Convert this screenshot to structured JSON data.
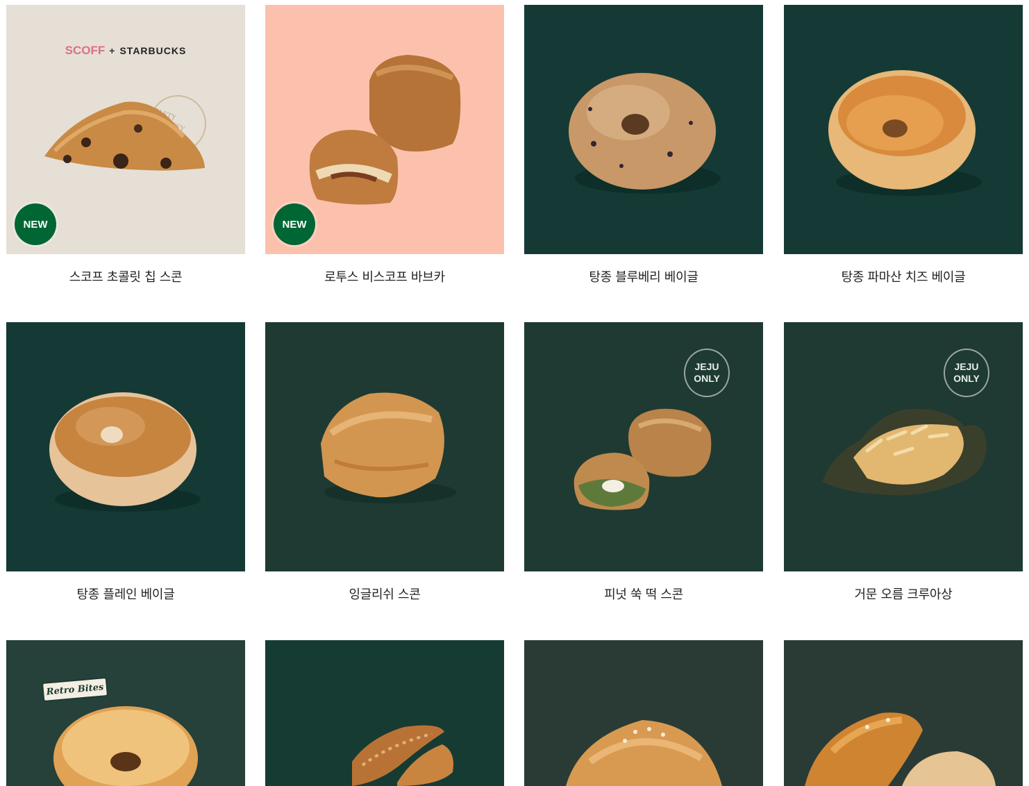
{
  "products": [
    {
      "name": "스코프 초콜릿 칩 스콘",
      "bg": "#e6dfd6",
      "badge": "NEW",
      "collab": {
        "left": "SCOFF",
        "plus": "+",
        "right": "STARBUCKS"
      },
      "stamp": "TASTY JOURNEY",
      "item": "scone"
    },
    {
      "name": "로투스 비스코프 바브카",
      "bg": "#fcc1ad",
      "badge": "NEW",
      "item": "babka"
    },
    {
      "name": "탕종 블루베리 베이글",
      "bg": "#153a35",
      "item": "bagel-blueberry"
    },
    {
      "name": "탕종 파마산 치즈 베이글",
      "bg": "#153a35",
      "item": "bagel-cheese"
    },
    {
      "name": "탕종 플레인 베이글",
      "bg": "#153a35",
      "item": "bagel-plain"
    },
    {
      "name": "잉글리쉬 스콘",
      "bg": "#1e3a33",
      "item": "scone-english"
    },
    {
      "name": "피넛 쑥 떡 스콘",
      "bg": "#1e3a33",
      "jeju": {
        "line1": "JEJU",
        "line2": "ONLY"
      },
      "item": "scone-mugwort"
    },
    {
      "name": "거문 오름 크루아상",
      "bg": "#1e3a33",
      "jeju": {
        "line1": "JEJU",
        "line2": "ONLY"
      },
      "item": "croissant-black"
    },
    {
      "name": "",
      "bg": "#26403a",
      "retro": "Retro Bites",
      "item": "donut"
    },
    {
      "name": "",
      "bg": "#163b32",
      "item": "churro"
    },
    {
      "name": "",
      "bg": "#2a3b36",
      "item": "salt-bread"
    },
    {
      "name": "",
      "bg": "#2a3b36",
      "item": "sausage-bread"
    }
  ]
}
